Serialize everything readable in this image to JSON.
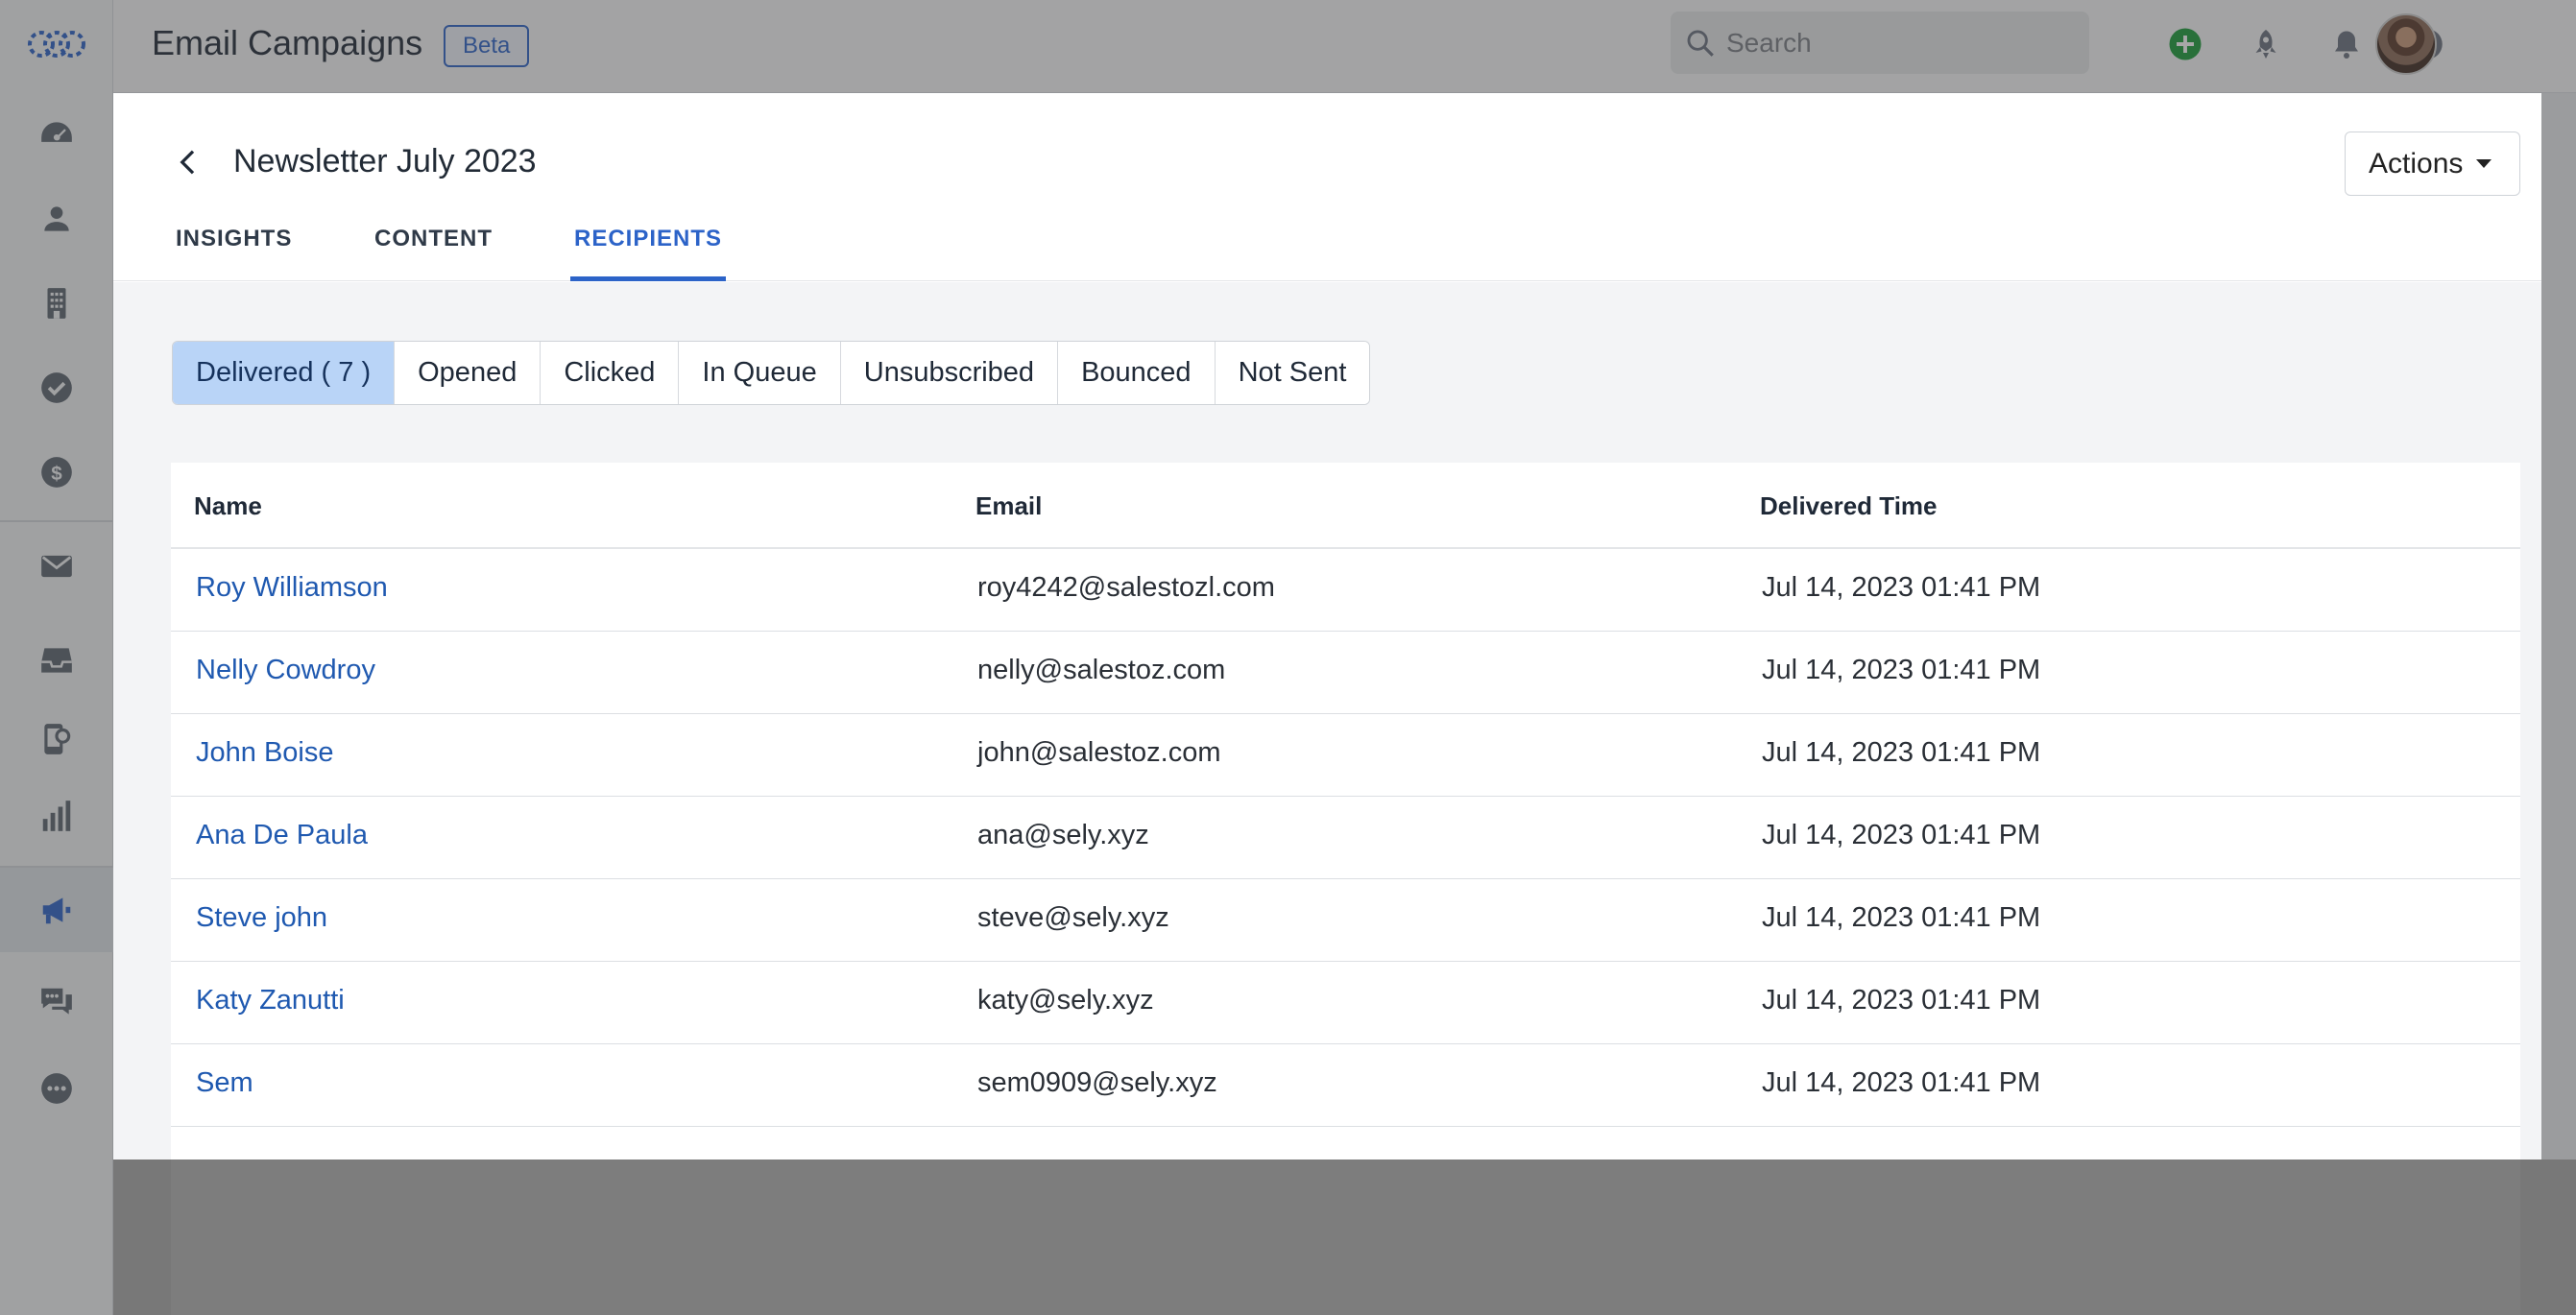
{
  "topbar": {
    "app_title": "Email Campaigns",
    "beta_label": "Beta",
    "search_placeholder": "Search"
  },
  "colors": {
    "accent": "#2c63c8",
    "link": "#1f59b0",
    "add_green": "#1a9b3a"
  },
  "sidebar": {
    "items": [
      {
        "icon": "dashboard-icon"
      },
      {
        "icon": "contacts-icon"
      },
      {
        "icon": "accounts-icon"
      },
      {
        "icon": "tasks-icon"
      },
      {
        "icon": "deals-icon"
      },
      {
        "icon": "email-icon"
      },
      {
        "icon": "inbox-icon"
      },
      {
        "icon": "phone-icon"
      },
      {
        "icon": "reports-icon"
      },
      {
        "icon": "campaigns-icon",
        "active": true
      },
      {
        "icon": "chat-icon"
      },
      {
        "icon": "more-icon"
      }
    ]
  },
  "campaign": {
    "title": "Newsletter July 2023",
    "actions_label": "Actions",
    "tabs": [
      {
        "label": "INSIGHTS"
      },
      {
        "label": "CONTENT"
      },
      {
        "label": "RECIPIENTS",
        "active": true
      }
    ]
  },
  "filters": [
    {
      "label": "Delivered ( 7 )",
      "active": true
    },
    {
      "label": "Opened"
    },
    {
      "label": "Clicked"
    },
    {
      "label": "In Queue"
    },
    {
      "label": "Unsubscribed"
    },
    {
      "label": "Bounced"
    },
    {
      "label": "Not Sent"
    }
  ],
  "table": {
    "headers": {
      "name": "Name",
      "email": "Email",
      "time": "Delivered Time"
    },
    "rows": [
      {
        "name": "Roy Williamson",
        "email": "roy4242@salestozl.com",
        "time": "Jul 14, 2023 01:41 PM"
      },
      {
        "name": "Nelly Cowdroy",
        "email": "nelly@salestoz.com",
        "time": "Jul 14, 2023 01:41 PM"
      },
      {
        "name": "John Boise",
        "email": "john@salestoz.com",
        "time": "Jul 14, 2023 01:41 PM"
      },
      {
        "name": "Ana De Paula",
        "email": "ana@sely.xyz",
        "time": "Jul 14, 2023 01:41 PM"
      },
      {
        "name": "Steve john",
        "email": "steve@sely.xyz",
        "time": "Jul 14, 2023 01:41 PM"
      },
      {
        "name": "Katy Zanutti",
        "email": "katy@sely.xyz",
        "time": "Jul 14, 2023 01:41 PM"
      },
      {
        "name": "Sem",
        "email": "sem0909@sely.xyz",
        "time": "Jul 14, 2023 01:41 PM"
      }
    ]
  }
}
